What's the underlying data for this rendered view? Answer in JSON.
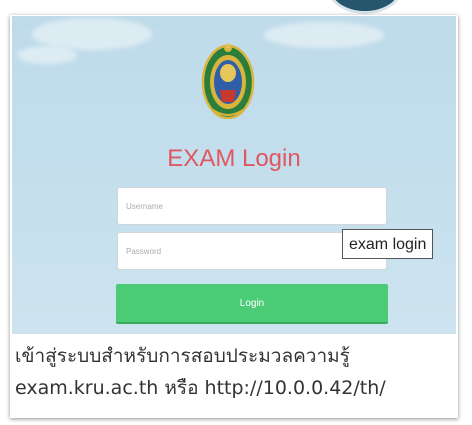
{
  "login_card": {
    "title": "EXAM Login",
    "username_placeholder": "Username",
    "password_placeholder": "Password",
    "login_label": "Login"
  },
  "tooltip": {
    "text": "exam login"
  },
  "caption": {
    "line1": "เข้าสู่ระบบสำหรับการสอบประมวลความรู้",
    "line2": "exam.kru.ac.th หรือ http://10.0.0.42/th/"
  },
  "emblem": {
    "icon": "university-emblem-icon"
  },
  "colors": {
    "background_sky": "#c3deec",
    "title": "#e05762",
    "login_button": "#4ccb76",
    "emblem_green": "#2a7d3a",
    "emblem_gold": "#d9b53e"
  }
}
